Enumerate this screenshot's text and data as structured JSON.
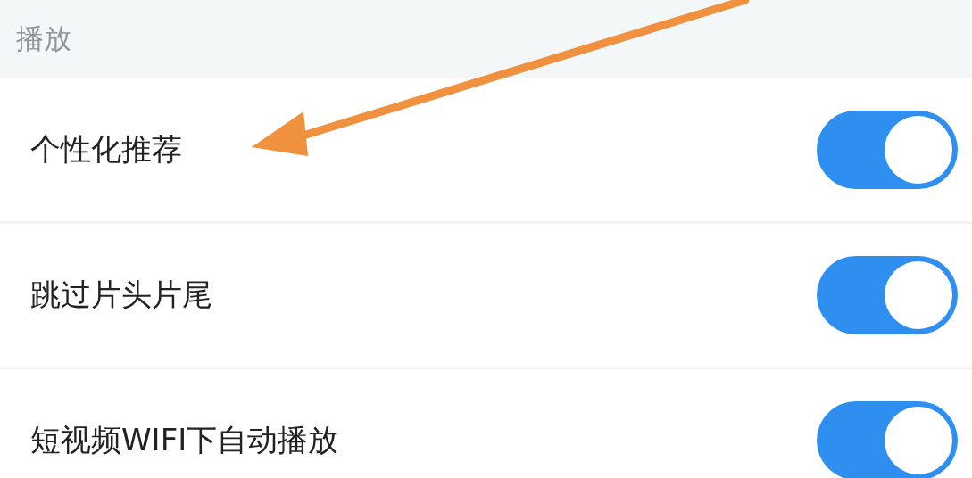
{
  "section": {
    "title": "播放"
  },
  "settings": [
    {
      "label": "个性化推荐",
      "on": true
    },
    {
      "label": "跳过片头片尾",
      "on": true
    },
    {
      "label": "短视频WIFI下自动播放",
      "on": true
    }
  ]
}
